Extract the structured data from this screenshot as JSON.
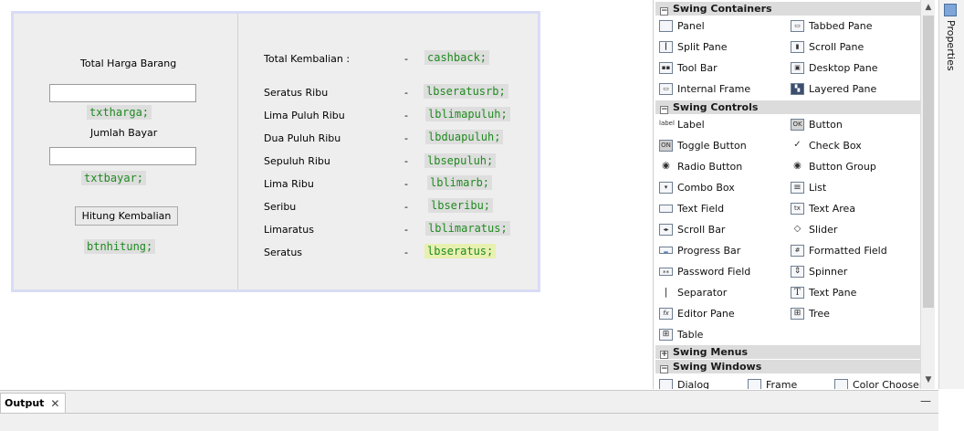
{
  "form": {
    "total_harga_label": "Total Harga Barang",
    "txtharga_code": "txtharga;",
    "jumlah_bayar_label": "Jumlah Bayar",
    "txtbayar_code": "txtbayar;",
    "hitung_button": "Hitung Kembalian",
    "btnhitung_code": "btnhitung;",
    "rows": [
      {
        "label": "Total Kembalian :",
        "dash": "-",
        "code": "cashback;"
      },
      {
        "label": "Seratus Ribu",
        "dash": "-",
        "code": "lbseratusrb;"
      },
      {
        "label": "Lima Puluh Ribu",
        "dash": "-",
        "code": "lblimapuluh;"
      },
      {
        "label": "Dua Puluh Ribu",
        "dash": "-",
        "code": "lbduapuluh;"
      },
      {
        "label": "Sepuluh Ribu",
        "dash": "-",
        "code": "lbsepuluh;"
      },
      {
        "label": "Lima Ribu",
        "dash": "-",
        "code": "lblimarb;"
      },
      {
        "label": "Seribu",
        "dash": "-",
        "code": "lbseribu;"
      },
      {
        "label": "Limaratus",
        "dash": "-",
        "code": "lblimaratus;"
      },
      {
        "label": "Seratus",
        "dash": "-",
        "code": "lbseratus;"
      }
    ]
  },
  "palette": {
    "categories": {
      "containers": "Swing Containers",
      "controls": "Swing Controls",
      "menus": "Swing Menus",
      "windows": "Swing Windows"
    },
    "containers": [
      {
        "label": "Panel",
        "icon": "panel-icon"
      },
      {
        "label": "Tabbed Pane",
        "icon": "tabbed-pane-icon"
      },
      {
        "label": "Split Pane",
        "icon": "split-pane-icon"
      },
      {
        "label": "Scroll Pane",
        "icon": "scroll-pane-icon"
      },
      {
        "label": "Tool Bar",
        "icon": "tool-bar-icon"
      },
      {
        "label": "Desktop Pane",
        "icon": "desktop-pane-icon"
      },
      {
        "label": "Internal Frame",
        "icon": "internal-frame-icon"
      },
      {
        "label": "Layered Pane",
        "icon": "layered-pane-icon"
      }
    ],
    "controls": [
      {
        "label": "Label",
        "icon": "label-icon",
        "glyph": "label"
      },
      {
        "label": "Button",
        "icon": "button-icon",
        "glyph": "OK"
      },
      {
        "label": "Toggle Button",
        "icon": "toggle-button-icon",
        "glyph": "ON"
      },
      {
        "label": "Check Box",
        "icon": "check-box-icon",
        "glyph": "✓"
      },
      {
        "label": "Radio Button",
        "icon": "radio-button-icon",
        "glyph": "◉"
      },
      {
        "label": "Button Group",
        "icon": "button-group-icon",
        "glyph": "◉"
      },
      {
        "label": "Combo Box",
        "icon": "combo-box-icon",
        "glyph": "▾"
      },
      {
        "label": "List",
        "icon": "list-icon",
        "glyph": "≡"
      },
      {
        "label": "Text Field",
        "icon": "text-field-icon",
        "glyph": ""
      },
      {
        "label": "Text Area",
        "icon": "text-area-icon",
        "glyph": "tx"
      },
      {
        "label": "Scroll Bar",
        "icon": "scroll-bar-icon",
        "glyph": "◂▸"
      },
      {
        "label": "Slider",
        "icon": "slider-icon",
        "glyph": "◇"
      },
      {
        "label": "Progress Bar",
        "icon": "progress-bar-icon",
        "glyph": "▬"
      },
      {
        "label": "Formatted Field",
        "icon": "formatted-field-icon",
        "glyph": "#"
      },
      {
        "label": "Password Field",
        "icon": "password-field-icon",
        "glyph": "**"
      },
      {
        "label": "Spinner",
        "icon": "spinner-icon",
        "glyph": "⇕"
      },
      {
        "label": "Separator",
        "icon": "separator-icon",
        "glyph": "|"
      },
      {
        "label": "Text Pane",
        "icon": "text-pane-icon",
        "glyph": "T"
      },
      {
        "label": "Editor Pane",
        "icon": "editor-pane-icon",
        "glyph": "fx"
      },
      {
        "label": "Tree",
        "icon": "tree-icon",
        "glyph": "⊞"
      },
      {
        "label": "Table",
        "icon": "table-icon",
        "glyph": "⊞"
      }
    ],
    "windows": [
      {
        "label": "Dialog",
        "icon": "dialog-icon"
      },
      {
        "label": "Frame",
        "icon": "frame-icon"
      },
      {
        "label": "Color Chooser",
        "icon": "color-chooser-icon"
      }
    ]
  },
  "properties_label": "Properties",
  "output": {
    "tab_label": "Output",
    "close": "✕",
    "minimize": "—"
  }
}
